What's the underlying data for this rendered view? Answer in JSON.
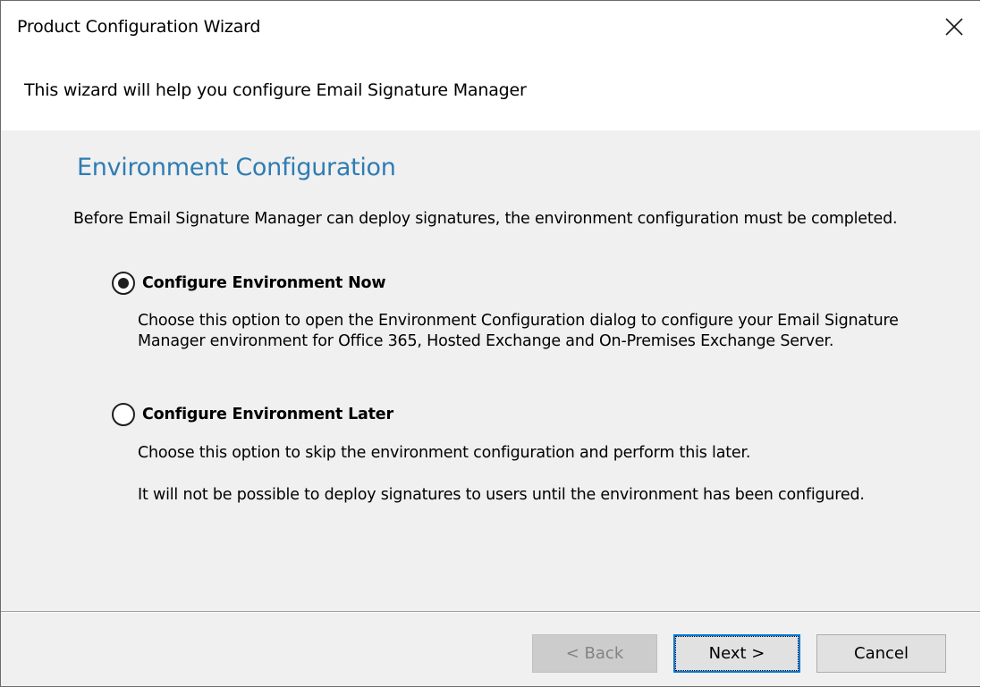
{
  "window": {
    "title": "Product Configuration Wizard",
    "close_icon": "close-icon"
  },
  "header": {
    "subtitle": "This wizard will help you configure Email Signature Manager"
  },
  "content": {
    "section_title": "Environment Configuration",
    "intro": "Before Email Signature Manager can deploy signatures, the environment configuration must be completed.",
    "options": [
      {
        "label": "Configure Environment Now",
        "selected": true,
        "description": "Choose this option to open the Environment Configuration dialog to configure your Email Signature Manager environment for Office 365, Hosted Exchange and On-Premises Exchange Server."
      },
      {
        "label": "Configure Environment Later",
        "selected": false,
        "description": "Choose this option to skip the environment configuration and perform this later.",
        "description_2": "It will not be possible to deploy signatures to users until the environment has been configured."
      }
    ]
  },
  "footer": {
    "back_label": "< Back",
    "back_enabled": false,
    "next_label": "Next >",
    "cancel_label": "Cancel"
  },
  "colors": {
    "section_title": "#2f7cb4",
    "dialog_background": "#f0f0f0",
    "header_background": "#ffffff",
    "default_button_border": "#0078d7"
  }
}
